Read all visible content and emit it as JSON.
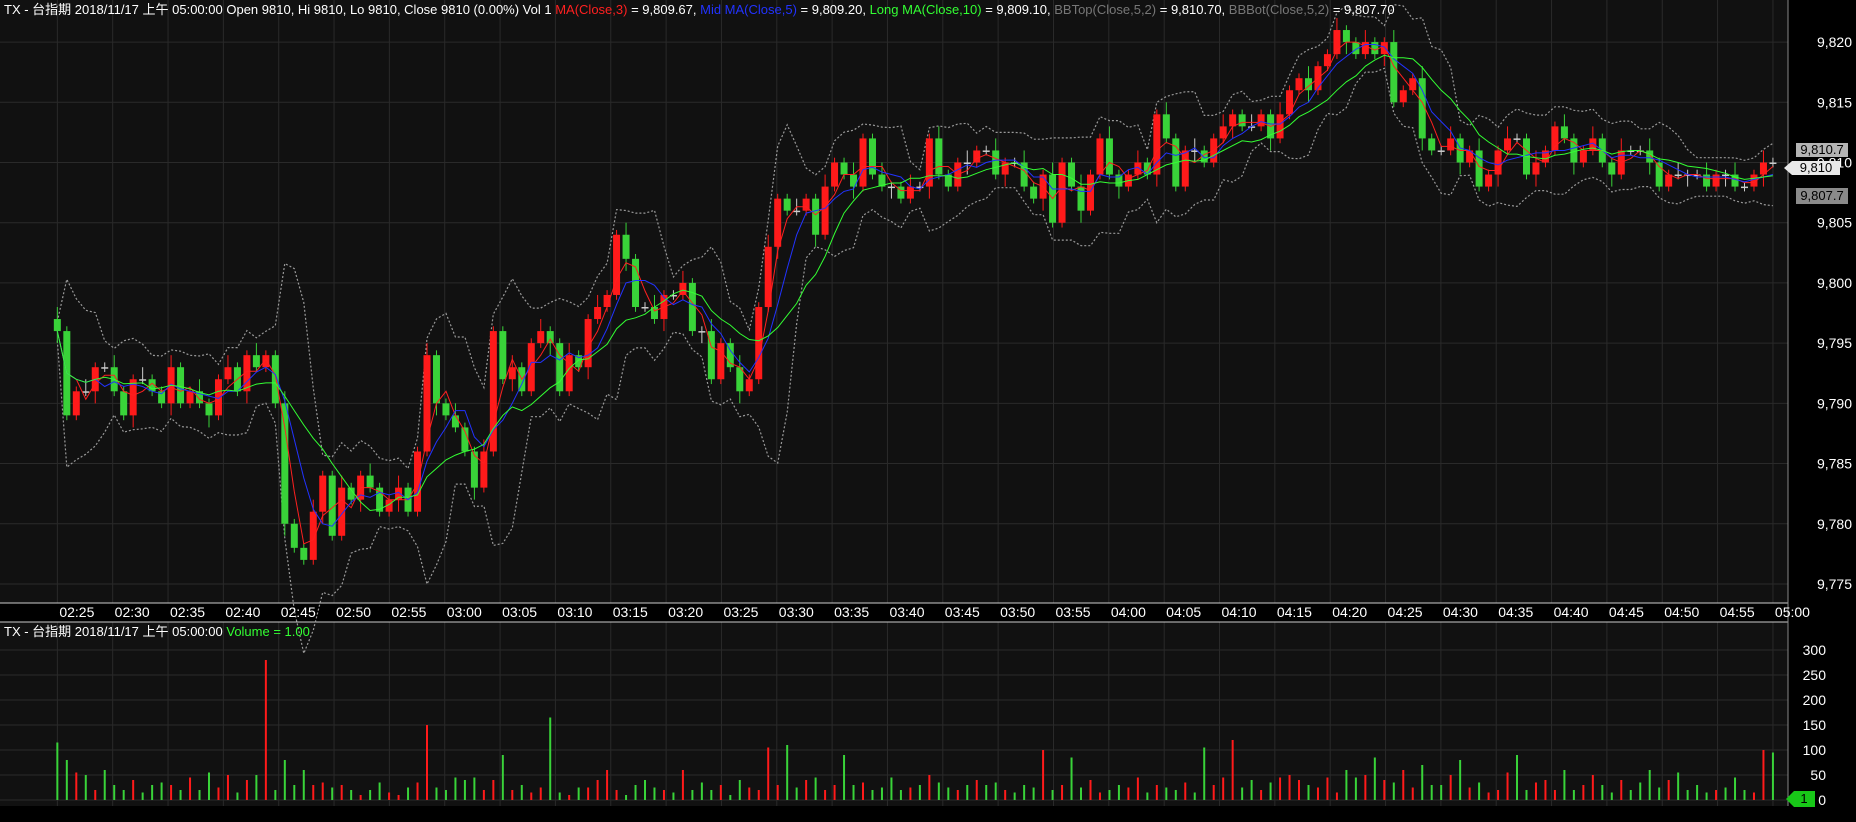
{
  "header": {
    "symbol": "TX - 台指期",
    "datetime": "2018/11/17 上午 05:00:00",
    "ohlc": "Open 9810, Hi 9810, Lo 9810, Close 9810 (0.00%) Vol 1",
    "ma3_label": "MA(Close,3)",
    "ma3_value": " = 9,809.67, ",
    "ma5_label": "Mid MA(Close,5)",
    "ma5_value": " = 9,809.20, ",
    "ma10_label": "Long MA(Close,10)",
    "ma10_value": " = 9,809.10, ",
    "bbtop_label": "BBTop(Close,5,2)",
    "bbtop_value": " = 9,810.70, ",
    "bbbot_label": "BBBot(Close,5,2)",
    "bbbot_value": " = 9,807.70"
  },
  "volume_header": {
    "symbol": "TX - 台指期",
    "datetime": "2018/11/17 上午 05:00:00",
    "volume_label": "Volume = 1.00"
  },
  "price_tags": {
    "bbtop": "9,810.7",
    "last": "9,810",
    "bbbot": "9,807.7"
  },
  "volume_tag": "1",
  "colors": {
    "up": "#ff1a1a",
    "down": "#39d339",
    "ma3": "#ff2020",
    "ma5": "#2233ff",
    "ma10": "#33ff33",
    "bb": "#9a9a9a",
    "grid": "#2a2a2a",
    "axis_text": "#ffffff",
    "background": "#000000",
    "panel": "#111111"
  },
  "chart_data": [
    {
      "type": "candlestick",
      "title": "TX - 台指期",
      "x_ticks": [
        "02:25",
        "02:30",
        "02:35",
        "02:40",
        "02:45",
        "02:50",
        "02:55",
        "03:00",
        "03:05",
        "03:10",
        "03:15",
        "03:20",
        "03:25",
        "03:30",
        "03:35",
        "03:40",
        "03:45",
        "03:50",
        "03:55",
        "04:00",
        "04:05",
        "04:10",
        "04:15",
        "04:20",
        "04:25",
        "04:30",
        "04:35",
        "04:40",
        "04:45",
        "04:50",
        "04:55",
        "05:00"
      ],
      "y_ticks": [
        9775,
        9780,
        9785,
        9790,
        9795,
        9800,
        9805,
        9810,
        9815,
        9820
      ],
      "y_tick_labels": [
        "9,775",
        "9,780",
        "9,785",
        "9,790",
        "9,795",
        "9,800",
        "9,805",
        "9,810",
        "9,815",
        "9,820"
      ],
      "ylim": [
        9774,
        9822
      ],
      "xlim": [
        "02:20",
        "05:01"
      ],
      "grid": true,
      "series": [
        {
          "name": "MA(Close,3)"
        },
        {
          "name": "Mid MA(Close,5)"
        },
        {
          "name": "Long MA(Close,10)"
        },
        {
          "name": "BBTop(Close,5,2)"
        },
        {
          "name": "BBBot(Close,5,2)"
        }
      ],
      "close": [
        9796,
        9789,
        9791,
        9791,
        9793,
        9793,
        9791,
        9789,
        9792,
        9792,
        9791,
        9790,
        9793,
        9790,
        9791,
        9790,
        9789,
        9792,
        9793,
        9791,
        9794,
        9793,
        9794,
        9790,
        9780,
        9778,
        9777,
        9781,
        9784,
        9779,
        9783,
        9782,
        9784,
        9783,
        9781,
        9782,
        9783,
        9781,
        9786,
        9794,
        9790,
        9789,
        9788,
        9786,
        9783,
        9786,
        9796,
        9792,
        9793,
        9791,
        9795,
        9796,
        9795,
        9791,
        9794,
        9793,
        9797,
        9798,
        9799,
        9804,
        9802,
        9798,
        9798,
        9797,
        9799,
        9799,
        9800,
        9796,
        9796,
        9792,
        9795,
        9793,
        9791,
        9792,
        9798,
        9803,
        9807,
        9806,
        9806,
        9807,
        9804,
        9808,
        9810,
        9809,
        9808,
        9812,
        9809,
        9808,
        9808,
        9807,
        9808,
        9808,
        9812,
        9809,
        9808,
        9810,
        9810,
        9811,
        9811,
        9809,
        9810,
        9810,
        9808,
        9807,
        9809,
        9805,
        9810,
        9808,
        9806,
        9809,
        9812,
        9809,
        9808,
        9809,
        9810,
        9809,
        9814,
        9812,
        9808,
        9811,
        9811,
        9810,
        9812,
        9813,
        9814,
        9813,
        9813,
        9814,
        9812,
        9814,
        9816,
        9817,
        9816,
        9818,
        9819,
        9821,
        9820,
        9819,
        9820,
        9819,
        9820,
        9815,
        9816,
        9817,
        9812,
        9811,
        9811,
        9812,
        9810,
        9811,
        9808,
        9809,
        9811,
        9812,
        9812,
        9809,
        9810,
        9811,
        9813,
        9812,
        9810,
        9811,
        9812,
        9810,
        9809,
        9811,
        9811,
        9811,
        9810,
        9808,
        9809,
        9809,
        9809,
        9809,
        9808,
        9809,
        9809,
        9808,
        9808,
        9809,
        9810,
        9810
      ],
      "volume": [
        115,
        80,
        55,
        50,
        20,
        60,
        30,
        20,
        40,
        15,
        30,
        35,
        30,
        20,
        45,
        20,
        55,
        25,
        50,
        15,
        40,
        50,
        280,
        20,
        80,
        30,
        60,
        30,
        35,
        25,
        30,
        20,
        10,
        20,
        35,
        15,
        10,
        25,
        35,
        150,
        25,
        20,
        45,
        40,
        45,
        20,
        40,
        90,
        20,
        30,
        15,
        25,
        165,
        15,
        10,
        25,
        25,
        40,
        60,
        20,
        10,
        30,
        40,
        25,
        20,
        15,
        60,
        20,
        35,
        20,
        30,
        10,
        40,
        25,
        20,
        105,
        30,
        110,
        25,
        40,
        45,
        20,
        30,
        90,
        30,
        35,
        20,
        25,
        45,
        20,
        25,
        30,
        50,
        35,
        25,
        20,
        30,
        40,
        30,
        35,
        20,
        15,
        30,
        25,
        100,
        20,
        30,
        85,
        25,
        40,
        15,
        20,
        30,
        25,
        45,
        15,
        30,
        25,
        20,
        35,
        15,
        105,
        30,
        45,
        120,
        25,
        40,
        20,
        35,
        45,
        50,
        40,
        30,
        25,
        45,
        15,
        60,
        45,
        50,
        85,
        40,
        35,
        60,
        25,
        70,
        30,
        30,
        50,
        80,
        25,
        35,
        15,
        20,
        55,
        90,
        20,
        35,
        40,
        20,
        60,
        20,
        30,
        50,
        30,
        15,
        40,
        20,
        35,
        60,
        25,
        40,
        55,
        20,
        30,
        15,
        20,
        25,
        45,
        20,
        15,
        100,
        95
      ]
    },
    {
      "type": "bar",
      "title": "Volume",
      "y_ticks": [
        0,
        50,
        100,
        150,
        200,
        250,
        300
      ],
      "ylim": [
        0,
        300
      ]
    }
  ]
}
